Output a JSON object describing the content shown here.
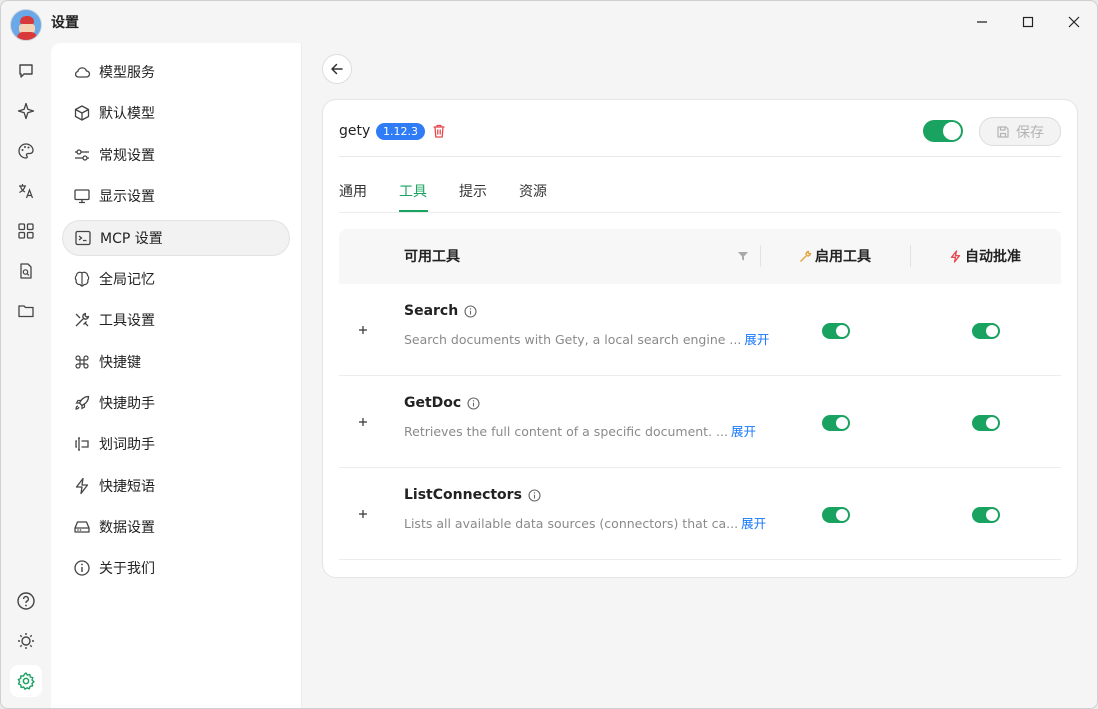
{
  "window": {
    "title": "设置"
  },
  "rail": {
    "items": [
      {
        "icon": "chat-icon"
      },
      {
        "icon": "sparkle-icon"
      },
      {
        "icon": "palette-icon"
      },
      {
        "icon": "translate-icon"
      },
      {
        "icon": "apps-grid-icon"
      },
      {
        "icon": "document-search-icon"
      },
      {
        "icon": "folder-icon"
      }
    ],
    "bottom": [
      {
        "icon": "help-icon"
      },
      {
        "icon": "brightness-icon"
      },
      {
        "icon": "settings-icon",
        "active": true
      }
    ]
  },
  "menu": {
    "items": [
      {
        "label": "模型服务",
        "icon": "cloud-icon"
      },
      {
        "label": "默认模型",
        "icon": "cube-icon"
      },
      {
        "label": "常规设置",
        "icon": "sliders-icon"
      },
      {
        "label": "显示设置",
        "icon": "monitor-icon"
      },
      {
        "label": "MCP 设置",
        "icon": "terminal-icon",
        "active": true
      },
      {
        "label": "全局记忆",
        "icon": "brain-icon"
      },
      {
        "label": "工具设置",
        "icon": "tools-icon"
      },
      {
        "label": "快捷键",
        "icon": "command-icon"
      },
      {
        "label": "快捷助手",
        "icon": "rocket-icon"
      },
      {
        "label": "划词助手",
        "icon": "text-cursor-icon"
      },
      {
        "label": "快捷短语",
        "icon": "zap-icon"
      },
      {
        "label": "数据设置",
        "icon": "drive-icon"
      },
      {
        "label": "关于我们",
        "icon": "info-icon"
      }
    ]
  },
  "server": {
    "name": "gety",
    "version": "1.12.3",
    "enabled": true,
    "save_label": "保存"
  },
  "tabs": [
    {
      "label": "通用"
    },
    {
      "label": "工具",
      "active": true
    },
    {
      "label": "提示"
    },
    {
      "label": "资源"
    }
  ],
  "table": {
    "col_tools": "可用工具",
    "col_enable": "启用工具",
    "col_auto": "自动批准",
    "more_label": "展开",
    "rows": [
      {
        "name": "Search",
        "desc": "Search documents with Gety, a local search engine ...",
        "enabled": true,
        "auto_approve": true
      },
      {
        "name": "GetDoc",
        "desc": "Retrieves the full content of a specific document. ...",
        "enabled": true,
        "auto_approve": true
      },
      {
        "name": "ListConnectors",
        "desc": "Lists all available data sources (connectors) that ca...",
        "enabled": true,
        "auto_approve": true
      }
    ]
  },
  "colors": {
    "accent": "#1aa260",
    "badge": "#2f7cf6",
    "link": "#1677ff",
    "danger": "#e5484d"
  }
}
